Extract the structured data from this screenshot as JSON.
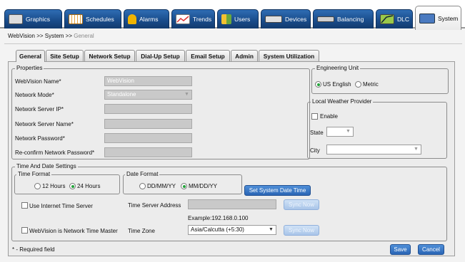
{
  "top_tabs": [
    {
      "label": "Graphics",
      "icon": "graphics-icon",
      "color": "#c8c8c8"
    },
    {
      "label": "Schedules",
      "icon": "calendar-icon",
      "color": "#e6a23c"
    },
    {
      "label": "Alarms",
      "icon": "alarm-bell-icon",
      "color": "#f0b400"
    },
    {
      "label": "Trends",
      "icon": "trend-chart-icon",
      "color": "#e8e8e8"
    },
    {
      "label": "Users",
      "icon": "users-icon",
      "color": "#f2c230"
    },
    {
      "label": "Devices",
      "icon": "device-icon",
      "color": "#d0d0d0"
    },
    {
      "label": "Balancing",
      "icon": "balancing-icon",
      "color": "#bcbcbc"
    },
    {
      "label": "DLC",
      "icon": "dlc-icon",
      "color": "#9ac94a"
    },
    {
      "label": "System",
      "icon": "system-icon",
      "color": "#4a7ac0"
    }
  ],
  "breadcrumb": {
    "part1": "WebVision",
    "sep": ">>",
    "part2": "System",
    "current": "General"
  },
  "sub_tabs": [
    "General",
    "Site Setup",
    "Network Setup",
    "Dial-Up Setup",
    "Email Setup",
    "Admin",
    "System Utilization"
  ],
  "properties": {
    "title": "Properties",
    "webvision_name_label": "WebVision Name*",
    "webvision_name_value": "WebVision",
    "network_mode_label": "Network Mode*",
    "network_mode_value": "Standalone",
    "network_server_ip_label": "Network Server IP*",
    "network_server_name_label": "Network Server Name*",
    "network_password_label": "Network Password*",
    "reconfirm_password_label": "Re-confirm Network Password*"
  },
  "engineering_unit": {
    "title": "Engineering Unit",
    "us_label": "US English",
    "metric_label": "Metric",
    "selected": "US English"
  },
  "weather": {
    "title": "Local Weather Provider",
    "enable_label": "Enable",
    "state_label": "State",
    "city_label": "City"
  },
  "time_date": {
    "title": "Time And Date Settings",
    "time_format_title": "Time Format",
    "h12_label": "12 Hours",
    "h24_label": "24 Hours",
    "date_format_title": "Date Format",
    "ddmmyy_label": "DD/MM/YY",
    "mmddyy_label": "MM/DD/YY",
    "set_datetime_button": "Set System Date Time",
    "use_internet_label": "Use Internet Time Server",
    "time_server_label": "Time Server Address",
    "sync_now_label": "Sync Now",
    "example_text": "Example:192.168.0.100",
    "master_label": "WebVision is Network Time Master",
    "time_zone_label": "Time Zone",
    "time_zone_value": "Asia/Calcutta (+5:30)"
  },
  "footer": {
    "required_note": "* - Required field",
    "save_label": "Save",
    "cancel_label": "Cancel"
  }
}
